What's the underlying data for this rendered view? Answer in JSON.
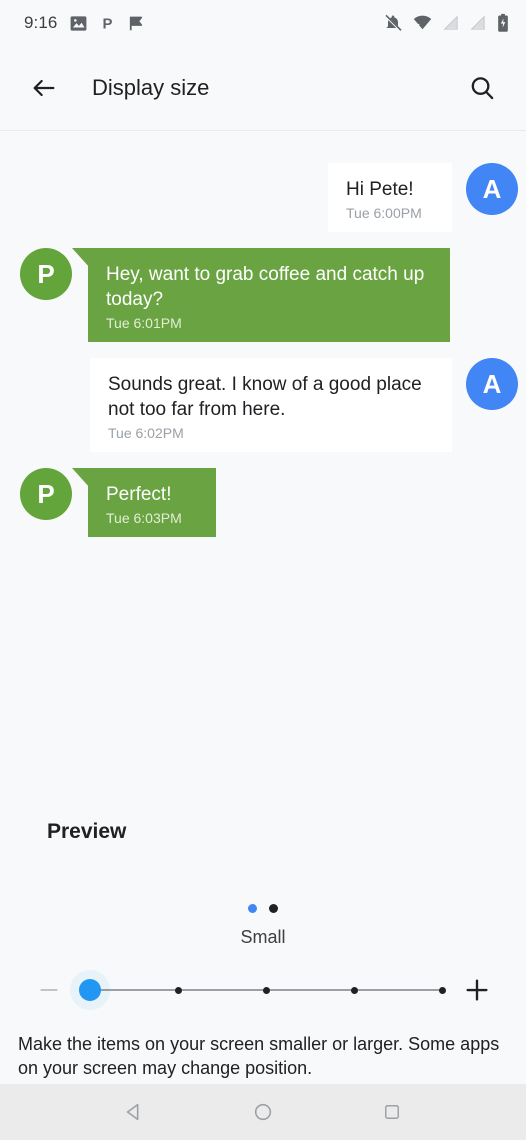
{
  "statusbar": {
    "time": "9:16",
    "left_icons": [
      "image-icon",
      "pushbullet-p-icon",
      "flag-icon"
    ],
    "right_icons": [
      "notifications-off-icon",
      "wifi-icon",
      "signal-empty-icon",
      "signal-empty-icon-2",
      "battery-charging-icon"
    ]
  },
  "appbar": {
    "back_label": "back-arrow",
    "title": "Display size",
    "search_label": "search"
  },
  "preview": {
    "heading": "Preview",
    "messages": [
      {
        "id": "msg1",
        "side": "right",
        "avatar": "A",
        "avatar_color": "#4285f4",
        "bubble_color": "#ffffff",
        "text": "Hi Pete!",
        "time": "Tue 6:00PM"
      },
      {
        "id": "msg2",
        "side": "left",
        "avatar": "P",
        "avatar_color": "#63a53a",
        "bubble_color": "#6aa442",
        "text": "Hey, want to grab coffee and catch up today?",
        "time": "Tue 6:01PM"
      },
      {
        "id": "msg3",
        "side": "right",
        "avatar": "A",
        "avatar_color": "#4285f4",
        "bubble_color": "#ffffff",
        "text": "Sounds great. I know of a good place not too far from here.",
        "time": "Tue 6:02PM"
      },
      {
        "id": "msg4",
        "side": "left",
        "avatar": "P",
        "avatar_color": "#63a53a",
        "bubble_color": "#6aa442",
        "text": "Perfect!",
        "time": "Tue 6:03PM"
      }
    ]
  },
  "pager": {
    "dots": [
      {
        "state": "active"
      },
      {
        "state": "inactive"
      }
    ],
    "current_index": 0
  },
  "slider": {
    "value_label": "Small",
    "value_index": 0,
    "steps": 5,
    "decrease_label": "−",
    "increase_label": "+",
    "decrease_enabled": false,
    "increase_enabled": true,
    "accent_color": "#2196f3"
  },
  "description": "Make the items on your screen smaller or larger. Some apps on your screen may change position.",
  "navbar": {
    "back_label": "back-triangle",
    "home_label": "home-circle",
    "recents_label": "recents-square"
  }
}
